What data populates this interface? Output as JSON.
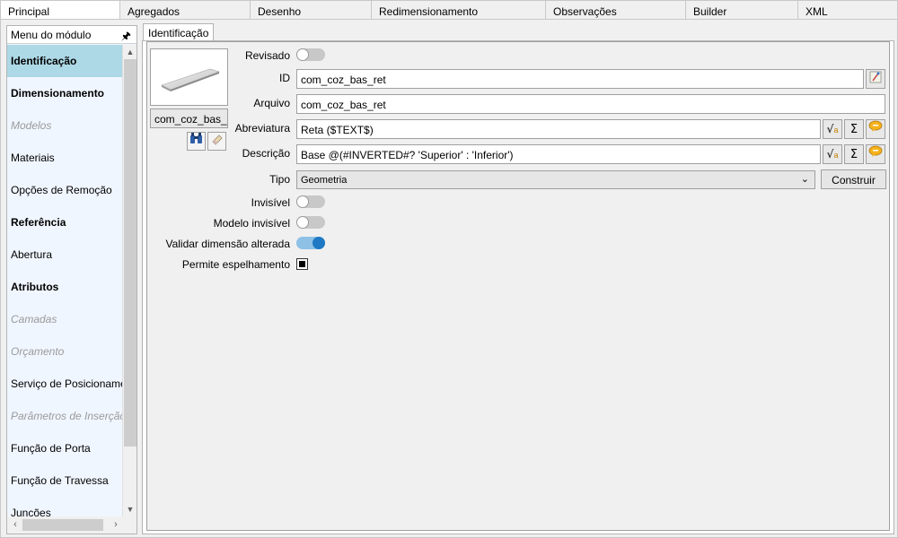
{
  "top_tabs": [
    {
      "label": "Principal",
      "active": true
    },
    {
      "label": "Agregados"
    },
    {
      "label": "Desenho"
    },
    {
      "label": "Redimensionamento"
    },
    {
      "label": "Observações"
    },
    {
      "label": "Builder"
    },
    {
      "label": "XML"
    }
  ],
  "side_menu": {
    "title": "Menu do módulo",
    "items": [
      {
        "label": "Identificação",
        "style": "bold",
        "active": true
      },
      {
        "label": "Dimensionamento",
        "style": "bold"
      },
      {
        "label": "Modelos",
        "style": "disabled"
      },
      {
        "label": "Materiais",
        "style": "normal"
      },
      {
        "label": "Opções de Remoção",
        "style": "normal"
      },
      {
        "label": "Referência",
        "style": "bold"
      },
      {
        "label": "Abertura",
        "style": "normal"
      },
      {
        "label": "Atributos",
        "style": "bold"
      },
      {
        "label": "Camadas",
        "style": "disabled"
      },
      {
        "label": "Orçamento",
        "style": "disabled"
      },
      {
        "label": "Serviço de Posicionamento",
        "style": "normal"
      },
      {
        "label": "Parâmetros de Inserção",
        "style": "disabled"
      },
      {
        "label": "Função de Porta",
        "style": "normal"
      },
      {
        "label": "Função de Travessa",
        "style": "normal"
      },
      {
        "label": "Junções",
        "style": "normal"
      }
    ]
  },
  "inner_tab": "Identificação",
  "preview": {
    "name": "com_coz_bas_ret"
  },
  "form": {
    "revisado": {
      "label": "Revisado",
      "on": false
    },
    "id": {
      "label": "ID",
      "value": "com_coz_bas_ret"
    },
    "arquivo": {
      "label": "Arquivo",
      "value": "com_coz_bas_ret"
    },
    "abreviatura": {
      "label": "Abreviatura",
      "value": "Reta ($TEXT$)"
    },
    "descricao": {
      "label": "Descrição",
      "value": "Base @(#INVERTED#? 'Superior' : 'Inferior')"
    },
    "tipo": {
      "label": "Tipo",
      "value": "Geometria",
      "button": "Construir"
    },
    "invisivel": {
      "label": "Invisível",
      "on": false
    },
    "modelo_invisivel": {
      "label": "Modelo invisível",
      "on": false
    },
    "validar": {
      "label": "Validar dimensão alterada",
      "on": true
    },
    "espelhamento": {
      "label": "Permite espelhamento",
      "checked": true
    }
  }
}
